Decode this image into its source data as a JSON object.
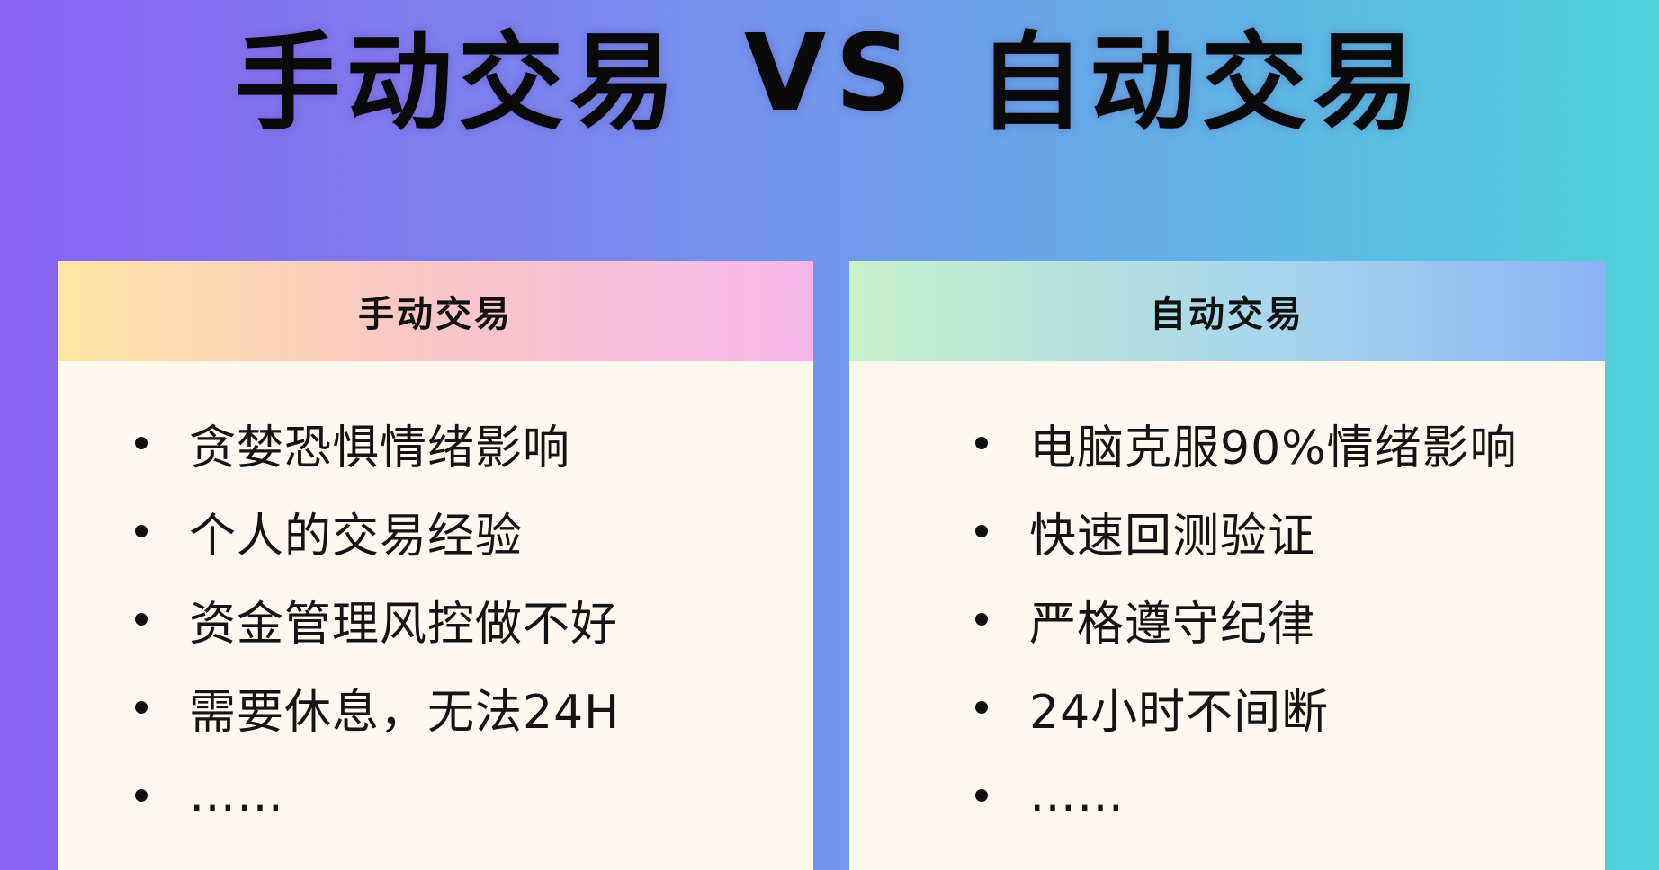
{
  "title": {
    "left": "手动交易",
    "vs": "VS",
    "right": "自动交易"
  },
  "cards": [
    {
      "header": "手动交易",
      "items": [
        "贪婪恐惧情绪影响",
        "个人的交易经验",
        "资金管理风控做不好",
        "需要休息，无法24H",
        "……"
      ]
    },
    {
      "header": "自动交易",
      "items": [
        "电脑克服90%情绪影响",
        "快速回测验证",
        "严格遵守纪律",
        "24小时不间断",
        "……"
      ]
    }
  ]
}
